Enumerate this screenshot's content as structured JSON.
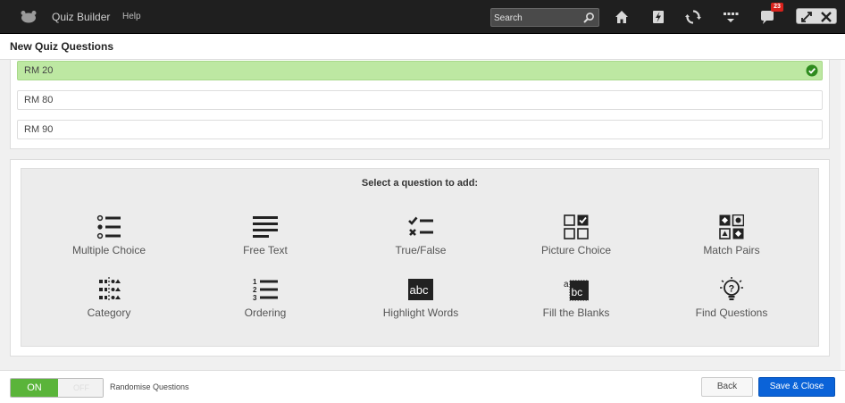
{
  "app": {
    "title": "Quiz Builder",
    "help": "Help",
    "search_placeholder": "Search",
    "notification_count": "23",
    "icons": [
      "home-icon",
      "pulse-icon",
      "sync-icon",
      "grid-menu-icon",
      "chat-icon",
      "fullscreen-icon",
      "close-icon"
    ]
  },
  "page": {
    "heading": "New Quiz Questions"
  },
  "answers": [
    {
      "text": "RM 20",
      "correct": true
    },
    {
      "text": "RM 80",
      "correct": false
    },
    {
      "text": "RM 90",
      "correct": false
    }
  ],
  "question_types": {
    "title": "Select a question to add:",
    "items": [
      {
        "label": "Multiple Choice",
        "icon": "multiple-choice-icon"
      },
      {
        "label": "Free Text",
        "icon": "free-text-icon"
      },
      {
        "label": "True/False",
        "icon": "true-false-icon"
      },
      {
        "label": "Picture Choice",
        "icon": "picture-choice-icon"
      },
      {
        "label": "Match Pairs",
        "icon": "match-pairs-icon"
      },
      {
        "label": "Category",
        "icon": "category-icon"
      },
      {
        "label": "Ordering",
        "icon": "ordering-icon"
      },
      {
        "label": "Highlight Words",
        "icon": "highlight-words-icon"
      },
      {
        "label": "Fill the Blanks",
        "icon": "fill-blanks-icon"
      },
      {
        "label": "Find Questions",
        "icon": "find-questions-icon"
      }
    ]
  },
  "footer": {
    "toggle_on": "ON",
    "toggle_off": "OFF",
    "toggle_label": "Randomise Questions",
    "back": "Back",
    "save": "Save & Close"
  },
  "colors": {
    "topbar": "#1f1f1f",
    "correct_answer": "#bde8a2",
    "check": "#2e8b1e",
    "toggle_on": "#5ab43a",
    "save_button": "#0b63d8",
    "badge": "#d9221c"
  }
}
